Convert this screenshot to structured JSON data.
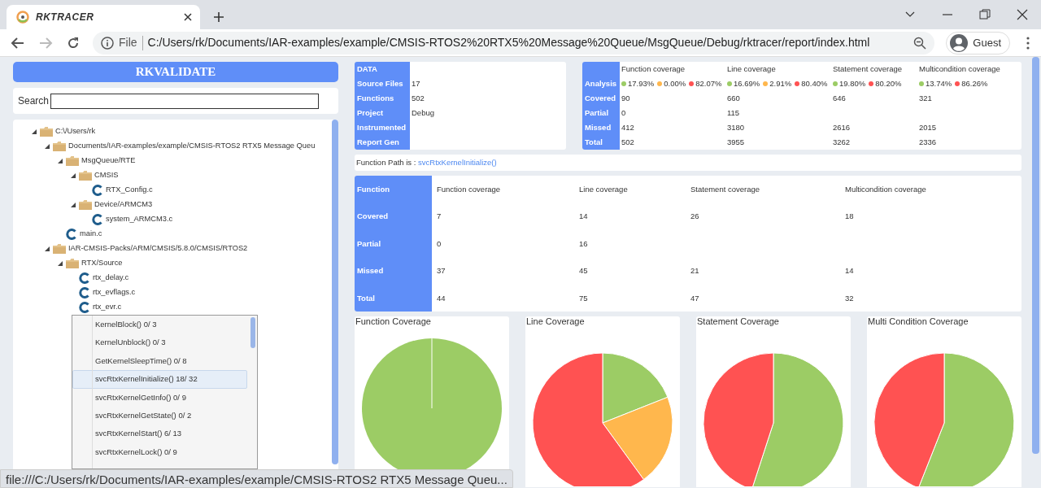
{
  "browser": {
    "tab_title": "RKTRACER",
    "address_prefix": "File",
    "url": "C:/Users/rk/Documents/IAR-examples/example/CMSIS-RTOS2%20RTX5%20Message%20Queue/MsgQueue/Debug/rktracer/report/index.html",
    "profile": "Guest"
  },
  "app_title": "RKVALIDATE",
  "search": {
    "label": "Search"
  },
  "tree": [
    {
      "kind": "folder",
      "label": "C:\\/Users/rk",
      "expanded": true,
      "children": [
        {
          "kind": "folder",
          "label": "Documents/IAR-examples/example/CMSIS-RTOS2 RTX5 Message Queu",
          "expanded": true,
          "children": [
            {
              "kind": "folder",
              "label": "MsgQueue/RTE",
              "expanded": true,
              "children": [
                {
                  "kind": "folder",
                  "label": "CMSIS",
                  "expanded": true,
                  "children": [
                    {
                      "kind": "file",
                      "label": "RTX_Config.c"
                    }
                  ]
                },
                {
                  "kind": "folder",
                  "label": "Device/ARMCM3",
                  "expanded": true,
                  "children": [
                    {
                      "kind": "file",
                      "label": "system_ARMCM3.c"
                    }
                  ]
                }
              ]
            },
            {
              "kind": "file",
              "label": "main.c"
            }
          ]
        },
        {
          "kind": "folder",
          "label": "IAR-CMSIS-Packs/ARM/CMSIS/5.8.0/CMSIS/RTOS2",
          "expanded": true,
          "children": [
            {
              "kind": "folder",
              "label": "RTX/Source",
              "expanded": true,
              "children": [
                {
                  "kind": "file",
                  "label": "rtx_delay.c"
                },
                {
                  "kind": "file",
                  "label": "rtx_evflags.c"
                },
                {
                  "kind": "file",
                  "label": "rtx_evr.c"
                }
              ]
            }
          ]
        }
      ]
    }
  ],
  "function_menu": [
    {
      "label": "KernelBlock()  0/ 3",
      "selected": false
    },
    {
      "label": "KernelUnblock()  0/ 3",
      "selected": false
    },
    {
      "label": "GetKernelSleepTime()  0/ 8",
      "selected": false
    },
    {
      "label": "svcRtxKernelInitialize()  18/ 32",
      "selected": true
    },
    {
      "label": "svcRtxKernelGetInfo()  0/ 9",
      "selected": false
    },
    {
      "label": "svcRtxKernelGetState()  0/ 2",
      "selected": false
    },
    {
      "label": "svcRtxKernelStart()  6/ 13",
      "selected": false
    },
    {
      "label": "svcRtxKernelLock()  0/ 9",
      "selected": false
    }
  ],
  "summary": [
    {
      "label": "DATA"
    },
    {
      "label": "Source Files",
      "value": "17"
    },
    {
      "label": "Functions",
      "value": "502"
    },
    {
      "label": "Project",
      "value": "Debug"
    },
    {
      "label": "Instrumented"
    },
    {
      "label": "Report Gen"
    }
  ],
  "coverage": {
    "columns": [
      "Function coverage",
      "Line coverage",
      "Statement coverage",
      "Multicondition coverage"
    ],
    "analysis": {
      "label": "Analysis",
      "cells": [
        [
          {
            "text": "17.93%",
            "color": "#9ccc65"
          },
          {
            "text": "0.00%",
            "color": "#ffb74d"
          },
          {
            "text": "82.07%",
            "color": "#ff5252"
          }
        ],
        [
          {
            "text": "16.69%",
            "color": "#9ccc65"
          },
          {
            "text": "2.91%",
            "color": "#ffb74d"
          },
          {
            "text": "80.40%",
            "color": "#ff5252"
          }
        ],
        [
          {
            "text": "19.80%",
            "color": "#9ccc65"
          },
          {
            "text": "80.20%",
            "color": "#ff5252"
          }
        ],
        [
          {
            "text": "13.74%",
            "color": "#9ccc65"
          },
          {
            "text": "86.26%",
            "color": "#ff5252"
          }
        ]
      ]
    },
    "rows": [
      {
        "label": "Covered",
        "cells": [
          "90",
          "660",
          "646",
          "321"
        ]
      },
      {
        "label": "Partial",
        "cells": [
          "0",
          "115",
          "",
          ""
        ]
      },
      {
        "label": "Missed",
        "cells": [
          "412",
          "3180",
          "2616",
          "2015"
        ]
      },
      {
        "label": "Total",
        "cells": [
          "502",
          "3955",
          "3262",
          "2336"
        ]
      }
    ]
  },
  "function_path": {
    "label": "Function Path is : ",
    "link": "svcRtxKernelInitialize()"
  },
  "function_table": {
    "header": "Function",
    "columns": [
      "Function coverage",
      "Line coverage",
      "Statement coverage",
      "Multicondition coverage"
    ],
    "rows": [
      {
        "label": "Covered",
        "cells": [
          "7",
          "14",
          "26",
          "18"
        ]
      },
      {
        "label": "Partial",
        "cells": [
          "0",
          "16",
          "",
          ""
        ]
      },
      {
        "label": "Missed",
        "cells": [
          "37",
          "45",
          "21",
          "14"
        ]
      },
      {
        "label": "Total",
        "cells": [
          "44",
          "75",
          "47",
          "32"
        ]
      }
    ]
  },
  "charts": [
    {
      "title": "Function Coverage"
    },
    {
      "title": "Line Coverage"
    },
    {
      "title": "Statement Coverage"
    },
    {
      "title": "Multi Condition Coverage"
    }
  ],
  "status_url": "file:///C:/Users/rk/Documents/IAR-examples/example/CMSIS-RTOS2 RTX5 Message Queu..."
}
